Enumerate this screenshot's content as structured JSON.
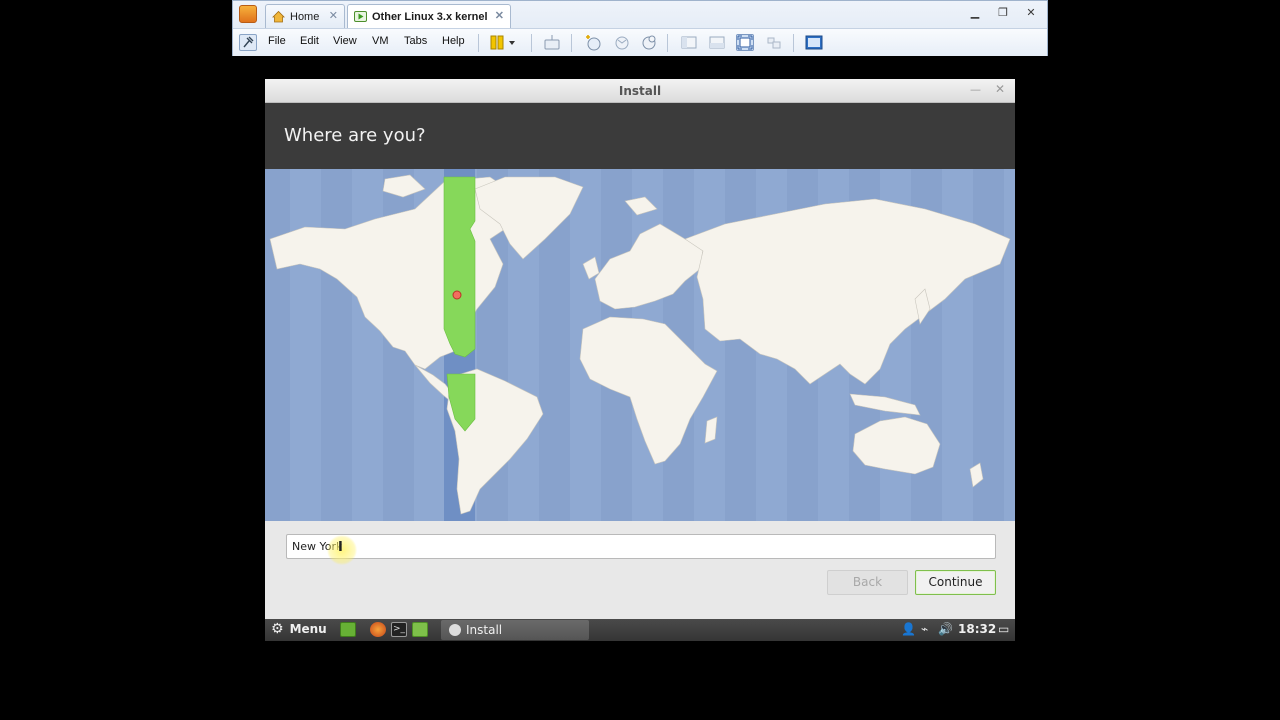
{
  "host": {
    "tabs": [
      {
        "label": "Home"
      },
      {
        "label": "Other Linux 3.x kernel"
      }
    ],
    "menu": [
      "File",
      "Edit",
      "View",
      "VM",
      "Tabs",
      "Help"
    ],
    "icons": [
      "vmware-app-icon",
      "home-icon",
      "vm-play-icon",
      "pin-icon",
      "pause-icon",
      "send-keys-icon",
      "snapshot-icon",
      "revert-icon",
      "snapshot-manager-icon",
      "console-view-icon",
      "thumbnail-view-icon",
      "fullscreen-icon",
      "unity-icon",
      "view-icon"
    ]
  },
  "installer": {
    "title": "Install",
    "heading": "Where are you?",
    "city_input_value": "New York",
    "back_label": "Back",
    "continue_label": "Continue",
    "map": {
      "ocean_color": "#8fa9d2",
      "land_color": "#f6f3ec",
      "highlight_color": "#86d85a",
      "selected_city": "New York"
    }
  },
  "panel": {
    "menu_label": "Menu",
    "task_label": "Install",
    "clock": "18:32"
  }
}
